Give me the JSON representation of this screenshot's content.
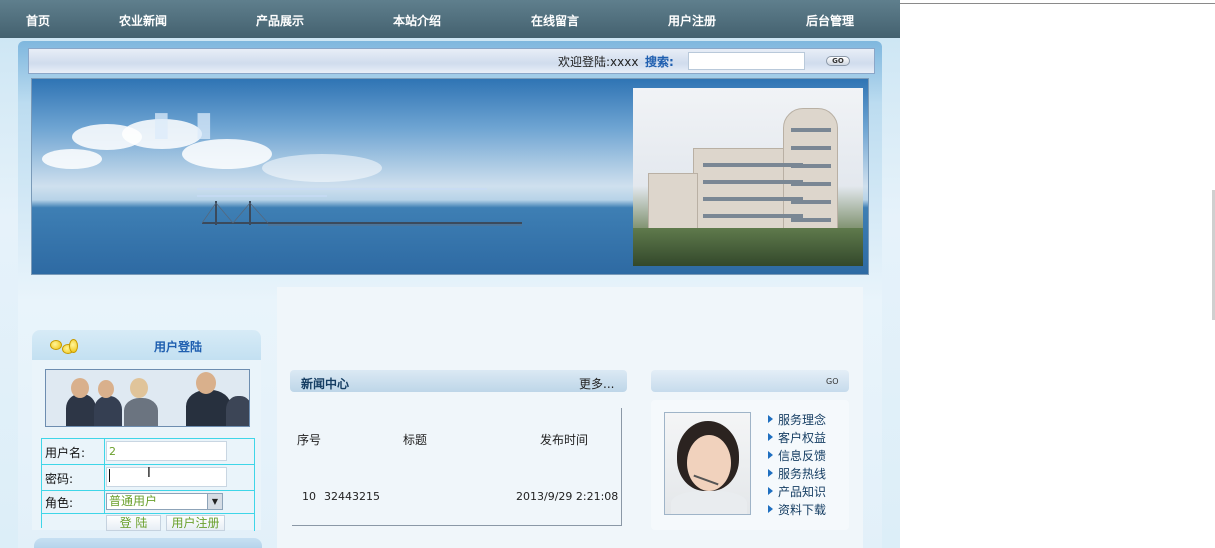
{
  "nav": [
    "首页",
    "农业新闻",
    "产品展示",
    "本站介绍",
    "在线留言",
    "用户注册",
    "后台管理"
  ],
  "header": {
    "welcome": "欢迎登陆:xxxx",
    "search_label": "搜索:",
    "search_value": "",
    "go_label": "GO"
  },
  "login": {
    "title": "用户登陆",
    "username_label": "用户名:",
    "username_value": "2",
    "password_label": "密码:",
    "password_value": "",
    "role_label": "角色:",
    "role_value": "普通用户",
    "login_button": "登 陆",
    "register_button": "用户注册"
  },
  "news": {
    "title": "新闻中心",
    "more": "更多...",
    "columns": [
      "序号",
      "标题",
      "发布时间"
    ],
    "rows": [
      {
        "id": "10",
        "title": "32443215",
        "time": "2013/9/29 2:21:08"
      }
    ]
  },
  "service": {
    "go_label": "GO",
    "items": [
      "服务理念",
      "客户权益",
      "信息反馈",
      "服务热线",
      "产品知识",
      "资料下载"
    ]
  },
  "colors": {
    "nav_bg": "#4f6e7c",
    "accent_blue": "#1f5fb0",
    "input_text": "#6aa02c",
    "grid_line": "#3fd6e8"
  }
}
